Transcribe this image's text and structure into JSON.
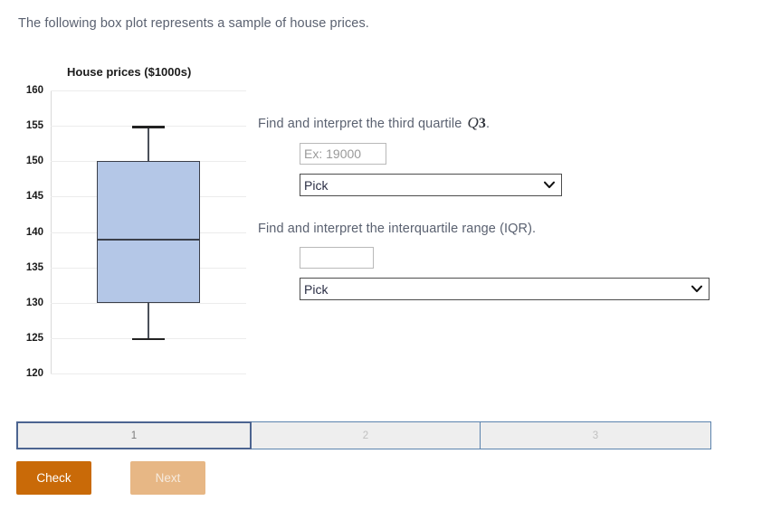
{
  "intro": {
    "text": "The following box plot represents a sample of house prices."
  },
  "chart_data": {
    "type": "box",
    "title": "House prices ($1000s)",
    "xlabel": "",
    "ylabel": "",
    "ylim": [
      120,
      160
    ],
    "ytick_step": 5,
    "ticks": [
      "160",
      "155",
      "150",
      "145",
      "140",
      "135",
      "130",
      "125",
      "120"
    ],
    "grid": true,
    "legend": "none",
    "categories": [
      "House prices"
    ],
    "boxes": [
      {
        "name": "House prices",
        "min": 125,
        "q1": 130,
        "median": 139,
        "q3": 150,
        "max": 155,
        "iqr": 20,
        "fill_color": "#b4c7e7",
        "line_color": "#3b3f4a"
      }
    ]
  },
  "questions": [
    {
      "prompt_before": "Find and interpret the third quartile ",
      "math_symbol": "Q",
      "math_sub": "3",
      "prompt_after": ".",
      "input_value": "",
      "input_placeholder": "Ex: 19000",
      "select_value": "Pick",
      "select_options": [
        "Pick"
      ]
    },
    {
      "prompt_before": "Find and interpret the interquartile range (IQR).",
      "math_symbol": "",
      "math_sub": "",
      "prompt_after": "",
      "input_value": "",
      "input_placeholder": "",
      "select_value": "Pick",
      "select_options": [
        "Pick"
      ]
    }
  ],
  "progress": {
    "steps": [
      {
        "label": "1",
        "active": true
      },
      {
        "label": "2",
        "active": false
      },
      {
        "label": "3",
        "active": false
      }
    ]
  },
  "buttons": {
    "check_label": "Check",
    "next_label": "Next"
  },
  "colors": {
    "check_button": "#c96a08",
    "next_button": "#e7b785",
    "box_fill": "#b4c7e7",
    "progress_active_border": "#4c6490",
    "progress_border": "#5b83ad"
  }
}
